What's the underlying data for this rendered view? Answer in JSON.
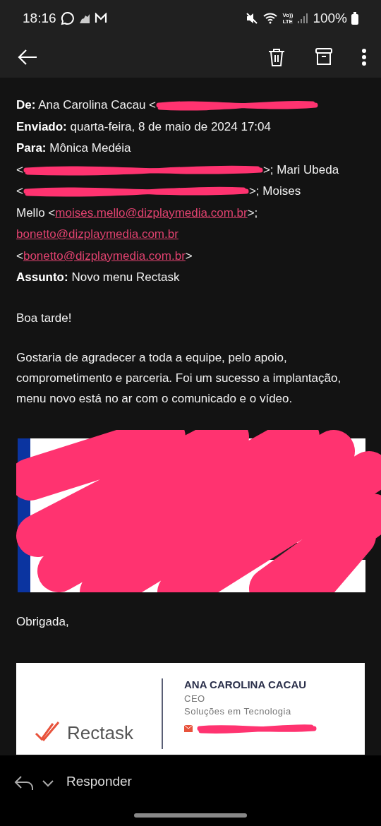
{
  "status_bar": {
    "time": "18:16",
    "volte": "Vo))",
    "lte": "LTE",
    "battery": "100%"
  },
  "header_lines": [
    {
      "parts": [
        {
          "kind": "label",
          "text": "De:"
        },
        {
          "kind": "plain",
          "text": " Ana Carolina Cacau <"
        },
        {
          "kind": "redacted"
        }
      ]
    },
    {
      "parts": [
        {
          "kind": "label",
          "text": "Enviado:"
        },
        {
          "kind": "plain",
          "text": " quarta-feira, 8 de maio de 2024 17:04"
        }
      ]
    },
    {
      "parts": [
        {
          "kind": "label",
          "text": "Para:"
        },
        {
          "kind": "plain",
          "text": " Mônica Medéia"
        }
      ]
    },
    {
      "parts": [
        {
          "kind": "plain",
          "text": "<"
        },
        {
          "kind": "redacted"
        },
        {
          "kind": "plain",
          "text": ">; Mari Ubeda"
        }
      ]
    },
    {
      "parts": [
        {
          "kind": "plain",
          "text": "<"
        },
        {
          "kind": "redacted"
        },
        {
          "kind": "plain",
          "text": ">; Moises"
        }
      ]
    },
    {
      "parts": [
        {
          "kind": "plain",
          "text": "Mello <"
        },
        {
          "kind": "link",
          "text": "moises.mello@dizplaymedia.com.br"
        },
        {
          "kind": "plain",
          "text": ">;"
        }
      ]
    },
    {
      "parts": [
        {
          "kind": "link",
          "text": "bonetto@dizplaymedia.com.br"
        }
      ]
    },
    {
      "parts": [
        {
          "kind": "plain",
          "text": "<"
        },
        {
          "kind": "link",
          "text": "bonetto@dizplaymedia.com.br"
        },
        {
          "kind": "plain",
          "text": ">"
        }
      ]
    },
    {
      "parts": [
        {
          "kind": "label",
          "text": "Assunto:"
        },
        {
          "kind": "plain",
          "text": " Novo menu Rectask"
        }
      ]
    }
  ],
  "body": [
    "Boa tarde!",
    "Gostaria de agradecer a toda a equipe, pelo apoio, comprometimento e parceria. Foi um sucesso a implantação, menu novo está no ar com o comunicado e o vídeo."
  ],
  "image": {
    "kind": "picture"
  },
  "closing": "Obrigada,",
  "signature": {
    "logo": "Rectask",
    "name": "ANA CAROLINA CACAU",
    "role": "CEO",
    "department": "Soluções em Tecnologia"
  },
  "reply_bar": {
    "label": "Responder"
  }
}
